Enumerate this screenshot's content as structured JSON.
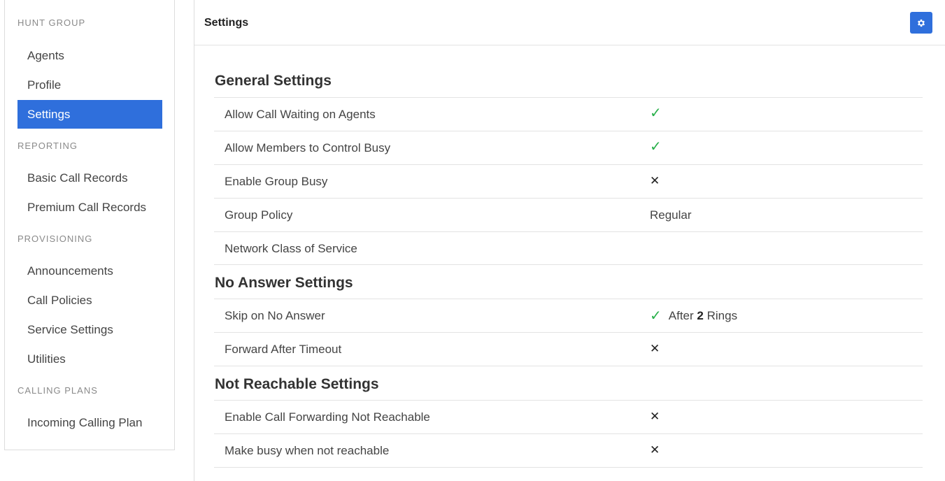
{
  "sidebar": {
    "sections": [
      {
        "title": "HUNT GROUP",
        "items": [
          "Agents",
          "Profile",
          "Settings"
        ]
      },
      {
        "title": "REPORTING",
        "items": [
          "Basic Call Records",
          "Premium Call Records"
        ]
      },
      {
        "title": "PROVISIONING",
        "items": [
          "Announcements",
          "Call Policies",
          "Service Settings",
          "Utilities"
        ]
      },
      {
        "title": "CALLING PLANS",
        "items": [
          "Incoming Calling Plan"
        ]
      }
    ],
    "active_item": "Settings"
  },
  "main": {
    "title": "Settings",
    "gear_icon": "gear-icon",
    "accent_color": "#2f6fdc",
    "general": {
      "title": "General Settings",
      "rows": [
        {
          "label": "Allow Call Waiting on Agents",
          "value": "check"
        },
        {
          "label": "Allow Members to Control Busy",
          "value": "check"
        },
        {
          "label": "Enable Group Busy",
          "value": "cross"
        },
        {
          "label": "Group Policy",
          "value": "Regular"
        },
        {
          "label": "Network Class of Service",
          "value": ""
        }
      ]
    },
    "no_answer": {
      "title": "No Answer Settings",
      "rows": [
        {
          "label": "Skip on No Answer",
          "value": "check",
          "after_prefix": "After",
          "after_count": "2",
          "after_suffix": "Rings"
        },
        {
          "label": "Forward After Timeout",
          "value": "cross"
        }
      ]
    },
    "not_reachable": {
      "title": "Not Reachable Settings",
      "rows": [
        {
          "label": "Enable Call Forwarding Not Reachable",
          "value": "cross"
        },
        {
          "label": "Make busy when not reachable",
          "value": "cross"
        }
      ]
    }
  }
}
